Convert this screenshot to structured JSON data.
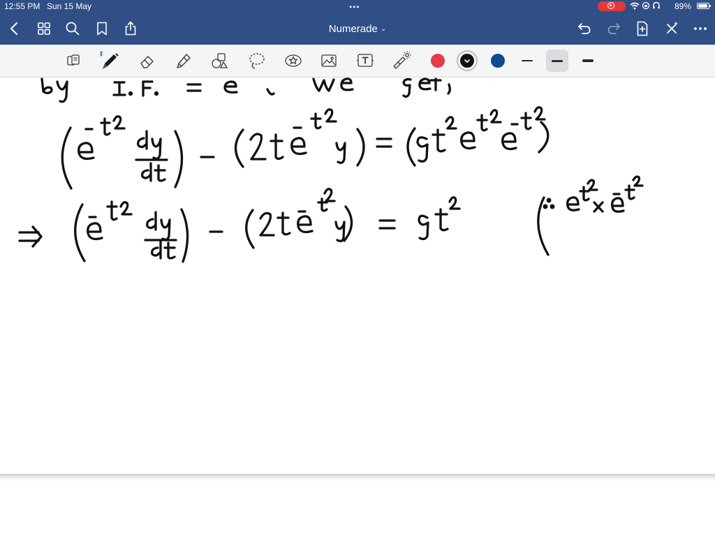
{
  "status_bar": {
    "time": "12:55 PM",
    "date": "Sun 15 May",
    "battery_percent": "89%",
    "icons": [
      "recording-icon",
      "wifi-icon",
      "orientation-lock-icon",
      "headphones-icon",
      "battery-icon"
    ]
  },
  "nav_bar": {
    "title": "Numerade",
    "icons": [
      "back-icon",
      "grid-icon",
      "search-icon",
      "bookmark-icon",
      "share-icon",
      "undo-icon",
      "redo-icon",
      "add-page-icon",
      "close-icon",
      "more-icon"
    ]
  },
  "toolbar": {
    "tools": [
      "read-mode-icon",
      "pen-icon",
      "eraser-icon",
      "highlighter-icon",
      "shapes-icon",
      "lasso-icon",
      "sticker-icon",
      "image-icon",
      "text-icon",
      "laser-pointer-icon"
    ],
    "colors": [
      "#e23d4a",
      "#111111",
      "#0e4a8e"
    ],
    "selected_color": "#111111",
    "stroke_sizes": [
      "thin",
      "medium",
      "thick"
    ],
    "selected_stroke_size": "medium"
  },
  "handwriting": {
    "line0": "by I.F. = e , we get,",
    "line1": "(e^{-t^2} dy/dt) - (2t e^{-t^2} y) = (9t^2 e^{t^2} e^{-t^2})",
    "line2": "⇒ (e^{-t^2} dy/dt) - (2t e^{-t^2} y) = 9t^2",
    "line2_note": "(∵ e^{t^2} × e^{-t^2}"
  }
}
